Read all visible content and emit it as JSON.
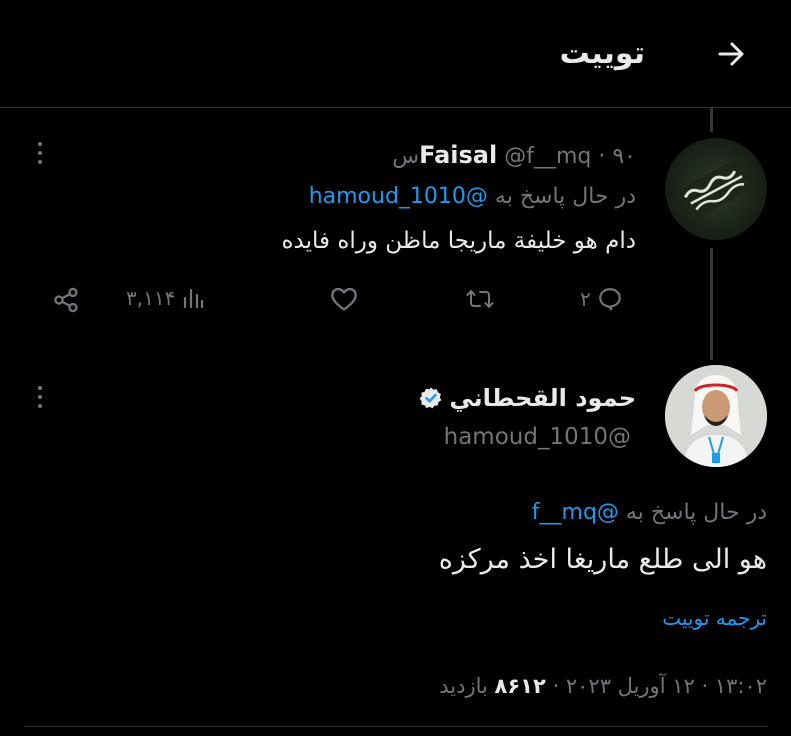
{
  "header": {
    "title": "توییت",
    "back_icon": "arrow-right-icon"
  },
  "reply_tweet": {
    "author_name": "Faisal",
    "handle": "@f__mq",
    "time_ago": "۹۰س",
    "replying_prefix": "در حال پاسخ به",
    "replying_to": "@hamoud_1010",
    "text": "دام هو خليفة ماريجا ماظن وراه فايده",
    "actions": {
      "replies": "۲",
      "views": "۳,۱۱۴"
    }
  },
  "main_tweet": {
    "author_name": "حمود القحطاني",
    "verified": true,
    "handle": "@hamoud_1010",
    "replying_prefix": "در حال پاسخ به",
    "replying_to": "@f__mq",
    "text": "هو الی طلع ماريغا اخذ مركزه",
    "translate_label": "ترجمه توییت",
    "timestamp": "۱۳:۰۲ · ۱۲ آوریل ۲۰۲۳ · ",
    "views_count": "۸۶۱۲",
    "views_label": " بازدید"
  },
  "colors": {
    "background": "#000000",
    "text": "#e7e9ea",
    "muted": "#71767b",
    "accent": "#1d9bf0",
    "divider": "#2f3336"
  }
}
